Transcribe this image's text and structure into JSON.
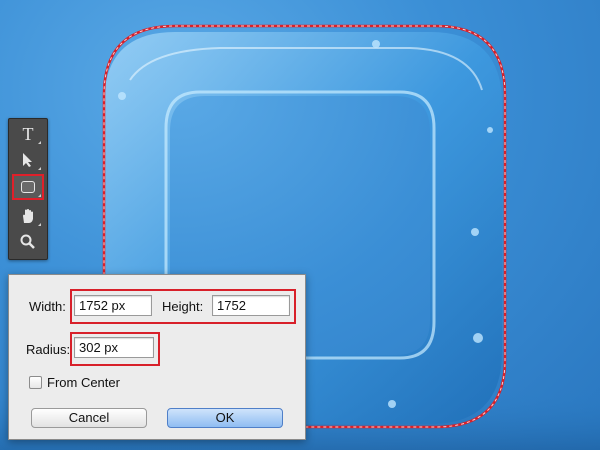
{
  "toolbar": {
    "tools": [
      {
        "name": "type-tool",
        "icon": "type-icon",
        "glyph": "T"
      },
      {
        "name": "path-selection-tool",
        "icon": "arrow-pointer-icon",
        "glyph": "➤"
      },
      {
        "name": "rounded-rectangle-tool",
        "icon": "rounded-rectangle-icon",
        "selected": true
      },
      {
        "name": "hand-tool",
        "icon": "hand-icon",
        "glyph": "✋"
      },
      {
        "name": "zoom-tool",
        "icon": "magnifier-icon",
        "glyph": "🔍"
      }
    ]
  },
  "dialog": {
    "width_label": "Width:",
    "width_value": "1752 px",
    "height_label": "Height:",
    "height_value": "1752",
    "radius_label": "Radius:",
    "radius_value": "302 px",
    "from_center_label": "From Center",
    "from_center_checked": false,
    "cancel_label": "Cancel",
    "ok_label": "OK"
  },
  "colors": {
    "highlight": "#d8202a",
    "background": "#3b8fd6",
    "ok_button": "#8fbdf2"
  }
}
